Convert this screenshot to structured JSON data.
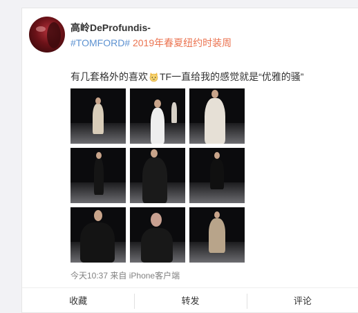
{
  "post": {
    "username": "高岭DeProfundis-",
    "hashtag": "#TOMFORD#",
    "topic": "2019年春夏纽约时装周",
    "content_before_emoji": "有几套格外的喜欢",
    "emoji_icon": "cat-face-emoji",
    "content_after_emoji": "TF一直给我的感觉就是“优雅的骚”",
    "timestamp": "今天10:37",
    "source_prefix": "来自",
    "source": "iPhone客户端"
  },
  "images": [
    {
      "name": "runway-photo-1"
    },
    {
      "name": "runway-photo-2"
    },
    {
      "name": "runway-photo-3"
    },
    {
      "name": "runway-photo-4"
    },
    {
      "name": "runway-photo-5"
    },
    {
      "name": "runway-photo-6"
    },
    {
      "name": "runway-photo-7"
    },
    {
      "name": "runway-photo-8"
    },
    {
      "name": "runway-photo-9"
    }
  ],
  "actions": {
    "favorite": "收藏",
    "repost": "转发",
    "comment": "评论"
  },
  "colors": {
    "hashtag": "#5d92d1",
    "topic": "#eb7350",
    "text": "#333333",
    "meta": "#808080"
  }
}
